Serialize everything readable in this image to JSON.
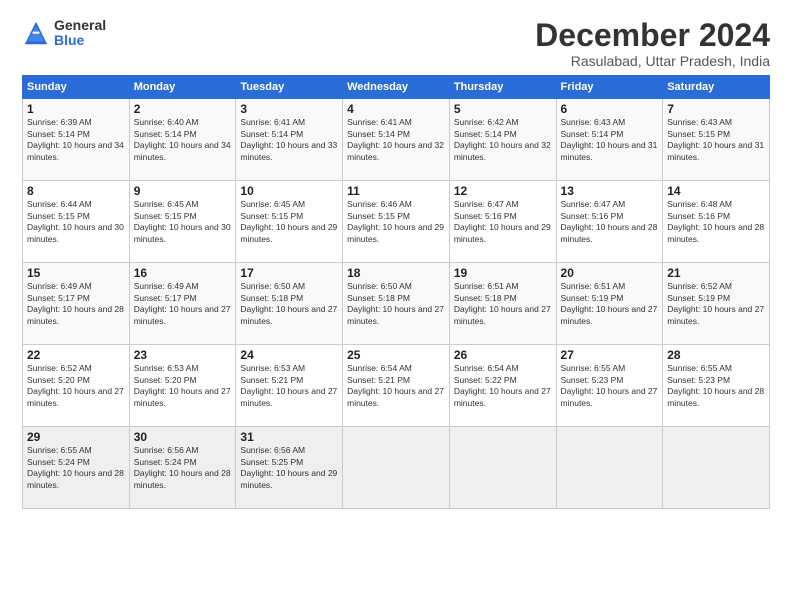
{
  "logo": {
    "general": "General",
    "blue": "Blue"
  },
  "title": "December 2024",
  "subtitle": "Rasulabad, Uttar Pradesh, India",
  "weekdays": [
    "Sunday",
    "Monday",
    "Tuesday",
    "Wednesday",
    "Thursday",
    "Friday",
    "Saturday"
  ],
  "weeks": [
    [
      {
        "day": "1",
        "sunrise": "Sunrise: 6:39 AM",
        "sunset": "Sunset: 5:14 PM",
        "daylight": "Daylight: 10 hours and 34 minutes."
      },
      {
        "day": "2",
        "sunrise": "Sunrise: 6:40 AM",
        "sunset": "Sunset: 5:14 PM",
        "daylight": "Daylight: 10 hours and 34 minutes."
      },
      {
        "day": "3",
        "sunrise": "Sunrise: 6:41 AM",
        "sunset": "Sunset: 5:14 PM",
        "daylight": "Daylight: 10 hours and 33 minutes."
      },
      {
        "day": "4",
        "sunrise": "Sunrise: 6:41 AM",
        "sunset": "Sunset: 5:14 PM",
        "daylight": "Daylight: 10 hours and 32 minutes."
      },
      {
        "day": "5",
        "sunrise": "Sunrise: 6:42 AM",
        "sunset": "Sunset: 5:14 PM",
        "daylight": "Daylight: 10 hours and 32 minutes."
      },
      {
        "day": "6",
        "sunrise": "Sunrise: 6:43 AM",
        "sunset": "Sunset: 5:14 PM",
        "daylight": "Daylight: 10 hours and 31 minutes."
      },
      {
        "day": "7",
        "sunrise": "Sunrise: 6:43 AM",
        "sunset": "Sunset: 5:15 PM",
        "daylight": "Daylight: 10 hours and 31 minutes."
      }
    ],
    [
      {
        "day": "8",
        "sunrise": "Sunrise: 6:44 AM",
        "sunset": "Sunset: 5:15 PM",
        "daylight": "Daylight: 10 hours and 30 minutes."
      },
      {
        "day": "9",
        "sunrise": "Sunrise: 6:45 AM",
        "sunset": "Sunset: 5:15 PM",
        "daylight": "Daylight: 10 hours and 30 minutes."
      },
      {
        "day": "10",
        "sunrise": "Sunrise: 6:45 AM",
        "sunset": "Sunset: 5:15 PM",
        "daylight": "Daylight: 10 hours and 29 minutes."
      },
      {
        "day": "11",
        "sunrise": "Sunrise: 6:46 AM",
        "sunset": "Sunset: 5:15 PM",
        "daylight": "Daylight: 10 hours and 29 minutes."
      },
      {
        "day": "12",
        "sunrise": "Sunrise: 6:47 AM",
        "sunset": "Sunset: 5:16 PM",
        "daylight": "Daylight: 10 hours and 29 minutes."
      },
      {
        "day": "13",
        "sunrise": "Sunrise: 6:47 AM",
        "sunset": "Sunset: 5:16 PM",
        "daylight": "Daylight: 10 hours and 28 minutes."
      },
      {
        "day": "14",
        "sunrise": "Sunrise: 6:48 AM",
        "sunset": "Sunset: 5:16 PM",
        "daylight": "Daylight: 10 hours and 28 minutes."
      }
    ],
    [
      {
        "day": "15",
        "sunrise": "Sunrise: 6:49 AM",
        "sunset": "Sunset: 5:17 PM",
        "daylight": "Daylight: 10 hours and 28 minutes."
      },
      {
        "day": "16",
        "sunrise": "Sunrise: 6:49 AM",
        "sunset": "Sunset: 5:17 PM",
        "daylight": "Daylight: 10 hours and 27 minutes."
      },
      {
        "day": "17",
        "sunrise": "Sunrise: 6:50 AM",
        "sunset": "Sunset: 5:18 PM",
        "daylight": "Daylight: 10 hours and 27 minutes."
      },
      {
        "day": "18",
        "sunrise": "Sunrise: 6:50 AM",
        "sunset": "Sunset: 5:18 PM",
        "daylight": "Daylight: 10 hours and 27 minutes."
      },
      {
        "day": "19",
        "sunrise": "Sunrise: 6:51 AM",
        "sunset": "Sunset: 5:18 PM",
        "daylight": "Daylight: 10 hours and 27 minutes."
      },
      {
        "day": "20",
        "sunrise": "Sunrise: 6:51 AM",
        "sunset": "Sunset: 5:19 PM",
        "daylight": "Daylight: 10 hours and 27 minutes."
      },
      {
        "day": "21",
        "sunrise": "Sunrise: 6:52 AM",
        "sunset": "Sunset: 5:19 PM",
        "daylight": "Daylight: 10 hours and 27 minutes."
      }
    ],
    [
      {
        "day": "22",
        "sunrise": "Sunrise: 6:52 AM",
        "sunset": "Sunset: 5:20 PM",
        "daylight": "Daylight: 10 hours and 27 minutes."
      },
      {
        "day": "23",
        "sunrise": "Sunrise: 6:53 AM",
        "sunset": "Sunset: 5:20 PM",
        "daylight": "Daylight: 10 hours and 27 minutes."
      },
      {
        "day": "24",
        "sunrise": "Sunrise: 6:53 AM",
        "sunset": "Sunset: 5:21 PM",
        "daylight": "Daylight: 10 hours and 27 minutes."
      },
      {
        "day": "25",
        "sunrise": "Sunrise: 6:54 AM",
        "sunset": "Sunset: 5:21 PM",
        "daylight": "Daylight: 10 hours and 27 minutes."
      },
      {
        "day": "26",
        "sunrise": "Sunrise: 6:54 AM",
        "sunset": "Sunset: 5:22 PM",
        "daylight": "Daylight: 10 hours and 27 minutes."
      },
      {
        "day": "27",
        "sunrise": "Sunrise: 6:55 AM",
        "sunset": "Sunset: 5:23 PM",
        "daylight": "Daylight: 10 hours and 27 minutes."
      },
      {
        "day": "28",
        "sunrise": "Sunrise: 6:55 AM",
        "sunset": "Sunset: 5:23 PM",
        "daylight": "Daylight: 10 hours and 28 minutes."
      }
    ],
    [
      {
        "day": "29",
        "sunrise": "Sunrise: 6:55 AM",
        "sunset": "Sunset: 5:24 PM",
        "daylight": "Daylight: 10 hours and 28 minutes."
      },
      {
        "day": "30",
        "sunrise": "Sunrise: 6:56 AM",
        "sunset": "Sunset: 5:24 PM",
        "daylight": "Daylight: 10 hours and 28 minutes."
      },
      {
        "day": "31",
        "sunrise": "Sunrise: 6:56 AM",
        "sunset": "Sunset: 5:25 PM",
        "daylight": "Daylight: 10 hours and 29 minutes."
      },
      null,
      null,
      null,
      null
    ]
  ]
}
